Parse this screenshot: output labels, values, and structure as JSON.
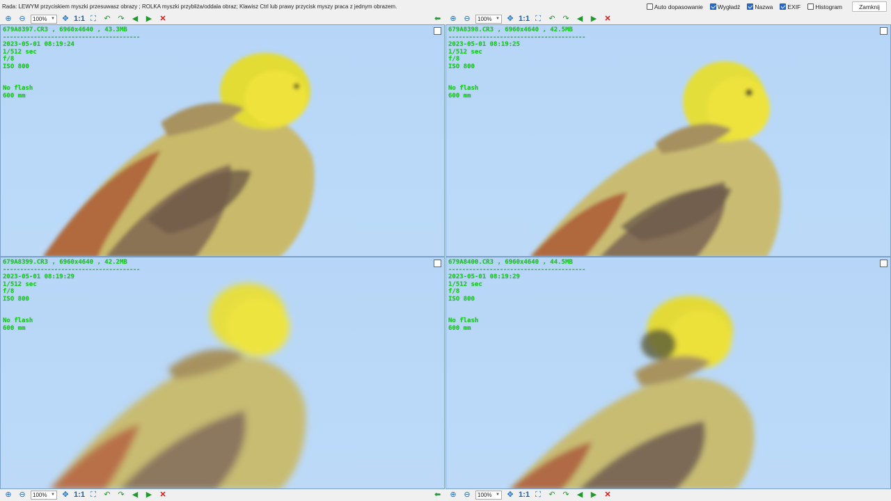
{
  "hint": "Rada: LEWYM przyciskiem myszki przesuwasz obrazy ; ROLKA myszki przybliża/oddala obraz; Klawisz Ctrl lub prawy przycisk myszy praca z jednym obrazem.",
  "options": [
    {
      "label": "Auto dopasowanie",
      "checked": false
    },
    {
      "label": "Wygładź",
      "checked": true
    },
    {
      "label": "Nazwa",
      "checked": true
    },
    {
      "label": "EXIF",
      "checked": true
    },
    {
      "label": "Histogram",
      "checked": false
    }
  ],
  "close_label": "Zamknij",
  "toolbar": {
    "zoom": "100%",
    "one_to_one": "1:1"
  },
  "separator": "----------------------------------------",
  "images": [
    {
      "file": "679A8397.CR3 , 6960x4640 , 43.3MB",
      "date": "2023-05-01 08:19:24",
      "shutter": "1/512 sec",
      "aperture": "f/8",
      "iso": "ISO 800",
      "flash": "No flash",
      "focal": "600 mm"
    },
    {
      "file": "679A8398.CR3 , 6960x4640 , 42.5MB",
      "date": "2023-05-01 08:19:25",
      "shutter": "1/512 sec",
      "aperture": "f/8",
      "iso": "ISO 800",
      "flash": "No flash",
      "focal": "600 mm"
    },
    {
      "file": "679A8399.CR3 , 6960x4640 , 42.2MB",
      "date": "2023-05-01 08:19:29",
      "shutter": "1/512 sec",
      "aperture": "f/8",
      "iso": "ISO 800",
      "flash": "No flash",
      "focal": "600 mm"
    },
    {
      "file": "679A8400.CR3 , 6960x4640 , 44.5MB",
      "date": "2023-05-01 08:19:29",
      "shutter": "1/512 sec",
      "aperture": "f/8",
      "iso": "ISO 800",
      "flash": "No flash",
      "focal": "600 mm"
    }
  ]
}
